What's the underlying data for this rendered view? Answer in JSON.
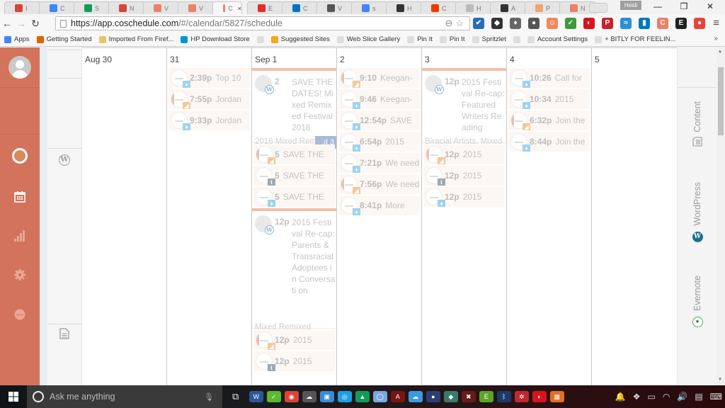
{
  "browser": {
    "tabs": [
      {
        "icon": "gmail-icon",
        "label": "I",
        "color": "#d44638"
      },
      {
        "icon": "google-calendar-icon",
        "label": "C",
        "color": "#4285f4"
      },
      {
        "icon": "google-drive-icon",
        "label": "S",
        "color": "#0f9d58"
      },
      {
        "icon": "gmail-icon",
        "label": "N",
        "color": "#d44638"
      },
      {
        "icon": "coschedule-icon",
        "label": "V",
        "color": "#e9826a"
      },
      {
        "icon": "coschedule-icon",
        "label": "V",
        "color": "#e9826a"
      },
      {
        "icon": "coschedule-icon",
        "label": "C",
        "color": "#e9826a",
        "active": true
      },
      {
        "icon": "youtube-icon",
        "label": "E",
        "color": "#e52d27"
      },
      {
        "icon": "outlook-icon",
        "label": "C",
        "color": "#0072c6"
      },
      {
        "icon": "site-icon",
        "label": "V",
        "color": "#555"
      },
      {
        "icon": "google-icon",
        "label": "s",
        "color": "#4285f4"
      },
      {
        "icon": "hootsuite-icon",
        "label": "H",
        "color": "#333"
      },
      {
        "icon": "office-icon",
        "label": "C",
        "color": "#eb3c00"
      },
      {
        "icon": "page-icon",
        "label": "H",
        "color": "#bbb"
      },
      {
        "icon": "g-icon",
        "label": "A",
        "color": "#333"
      },
      {
        "icon": "mailchimp-icon",
        "label": "P",
        "color": "#f0a56b"
      },
      {
        "icon": "coschedule-icon",
        "label": "N",
        "color": "#e9826a"
      }
    ],
    "tab_close": "×",
    "profile_name": "Heidi",
    "window_controls": {
      "minimize": "—",
      "restore": "❐",
      "close": "✕"
    },
    "url_host": "https://app.coschedule.com",
    "url_path": "/#/calendar/5827/schedule",
    "extensions": [
      {
        "name": "checklist-icon",
        "color": "#2a6db5",
        "glyph": "✔"
      },
      {
        "name": "hootsuite-icon",
        "color": "#333",
        "glyph": "◆"
      },
      {
        "name": "lamp-icon",
        "color": "#666",
        "glyph": "♦"
      },
      {
        "name": "evernote-icon",
        "color": "#555",
        "glyph": "●"
      },
      {
        "name": "mailchimp-icon",
        "color": "#f08a5d",
        "glyph": "☺"
      },
      {
        "name": "grammar-check-icon",
        "color": "#3d9a3d",
        "glyph": "✓"
      },
      {
        "name": "trend-micro-icon",
        "color": "#d9121e",
        "glyph": "◐"
      },
      {
        "name": "pinterest-icon",
        "color": "#cb2027",
        "glyph": "P"
      },
      {
        "name": "blue-wave-icon",
        "color": "#2b8fd6",
        "glyph": "≈"
      },
      {
        "name": "trello-icon",
        "color": "#0079bf",
        "glyph": "▮"
      },
      {
        "name": "coschedule-ext-icon",
        "color": "#e9826a",
        "glyph": "C"
      },
      {
        "name": "e-icon",
        "color": "#222",
        "glyph": "E"
      },
      {
        "name": "red-circle-icon",
        "color": "#e8443a",
        "glyph": "●"
      }
    ],
    "bookmarks": [
      {
        "icon": "apps-icon",
        "label": "Apps",
        "color": "#4285f4"
      },
      {
        "icon": "firefox-icon",
        "label": "Getting Started",
        "color": "#e66000"
      },
      {
        "icon": "folder-icon",
        "label": "Imported From Firef...",
        "color": "#e8c56a"
      },
      {
        "icon": "hp-icon",
        "label": "HP Download Store",
        "color": "#0096d6"
      },
      {
        "icon": "page-icon",
        "label": "",
        "color": "#ddd"
      },
      {
        "icon": "bing-icon",
        "label": "Suggested Sites",
        "color": "#f5a623"
      },
      {
        "icon": "page-icon",
        "label": "Web Slice Gallery",
        "color": "#ddd"
      },
      {
        "icon": "page-icon",
        "label": "Pin It",
        "color": "#ddd"
      },
      {
        "icon": "page-icon",
        "label": "Pin It",
        "color": "#ddd"
      },
      {
        "icon": "page-icon",
        "label": "Spritzlet",
        "color": "#ddd"
      },
      {
        "icon": "page-icon",
        "label": "",
        "color": "#ddd"
      },
      {
        "icon": "page-icon",
        "label": "Account Settings",
        "color": "#ddd"
      },
      {
        "icon": "page-icon",
        "label": "+ BITLY FOR FEELIN...",
        "color": "#ddd"
      }
    ],
    "bookmarks_more": "»"
  },
  "app": {
    "accent": "#d3735c",
    "nav": [
      "profile",
      "dashboard",
      "calendar",
      "analytics",
      "settings",
      "new"
    ],
    "days": [
      {
        "label": "Aug 30",
        "items": []
      },
      {
        "label": "31",
        "items": [
          {
            "time": "2:39p",
            "text": "Top 10",
            "network": "twitter"
          },
          {
            "time": "7:55p",
            "text": "Jordan",
            "network": "facebook",
            "photo": true
          },
          {
            "time": "9:33p",
            "text": "Jordan",
            "network": "twitter"
          }
        ]
      },
      {
        "label": "Sep 1",
        "blog1": {
          "count": "2",
          "title": "SAVE THE DATES! Mixed Remixed Festival 2016",
          "footer": "2016 Mixed Remixed",
          "stat": "3"
        },
        "items": [
          {
            "time": "5",
            "text": "SAVE THE",
            "network": "facebook",
            "photo": true
          },
          {
            "time": "5",
            "text": "SAVE THE",
            "network": "tumblr"
          },
          {
            "time": "5",
            "text": "SAVE THE",
            "network": "twitter"
          }
        ],
        "blog2": {
          "count": "12p",
          "title": "2015 Festival Re-cap: Parents & Transracial Adoptees in Conversati on",
          "footer": "Mixed Remixed"
        },
        "items2": [
          {
            "time": "12p",
            "text": "2015",
            "network": "facebook",
            "photo": true
          },
          {
            "time": "12p",
            "text": "2015",
            "network": "tumblr"
          }
        ]
      },
      {
        "label": "2",
        "items": [
          {
            "time": "9:10",
            "text": "Keegan-",
            "network": "facebook",
            "photo": true
          },
          {
            "time": "9:46",
            "text": "Keegan-",
            "network": "twitter"
          },
          {
            "time": "12:54p",
            "text": "SAVE",
            "network": "twitter"
          },
          {
            "time": "6:54p",
            "text": "2015",
            "network": "twitter"
          },
          {
            "time": "7:21p",
            "text": "We need",
            "network": "twitter"
          },
          {
            "time": "7:56p",
            "text": "We need",
            "network": "facebook",
            "photo": true
          },
          {
            "time": "8:41p",
            "text": "More",
            "network": "twitter"
          }
        ]
      },
      {
        "label": "3",
        "blog1": {
          "count": "12p",
          "title": "2015 Festival Re-cap: Featured Writers Reading",
          "footer": "Biracial Artists, Mixed"
        },
        "items": [
          {
            "time": "12p",
            "text": "2015",
            "network": "facebook",
            "photo": true
          },
          {
            "time": "12p",
            "text": "2015",
            "network": "tumblr"
          },
          {
            "time": "12p",
            "text": "2015",
            "network": "twitter"
          }
        ]
      },
      {
        "label": "4",
        "items": [
          {
            "time": "10:26",
            "text": "Call for",
            "network": "twitter"
          },
          {
            "time": "10:34",
            "text": "2015",
            "network": "twitter"
          },
          {
            "time": "6:32p",
            "text": "Join the",
            "network": "facebook",
            "photo": true
          },
          {
            "time": "8:44p",
            "text": "Join the",
            "network": "twitter"
          }
        ]
      },
      {
        "label": "5",
        "items": []
      }
    ],
    "right_tabs": [
      {
        "label": "Content",
        "icon": "content-icon"
      },
      {
        "label": "WordPress",
        "icon": "wordpress-icon"
      },
      {
        "label": "Evernote",
        "icon": "evernote-icon"
      }
    ]
  },
  "taskbar": {
    "search_placeholder": "Ask me anything",
    "apps": [
      {
        "name": "word-icon",
        "color": "#2b579a",
        "glyph": "W"
      },
      {
        "name": "green-check-icon",
        "color": "#5cb82e",
        "glyph": "✓"
      },
      {
        "name": "chrome-icon",
        "color": "#db4437",
        "glyph": "◉"
      },
      {
        "name": "onedrive-icon",
        "color": "#555",
        "glyph": "☁"
      },
      {
        "name": "app-icon",
        "color": "#3a8bd6",
        "glyph": "▣"
      },
      {
        "name": "app-icon",
        "color": "#1ba1e2",
        "glyph": "◎"
      },
      {
        "name": "google-drive-icon",
        "color": "#0f9d58",
        "glyph": "▲"
      },
      {
        "name": "app-icon",
        "color": "#7aa7e0",
        "glyph": "◯"
      },
      {
        "name": "acrobat-icon",
        "color": "#7a1414",
        "glyph": "A"
      },
      {
        "name": "icloud-icon",
        "color": "#3b9ae1",
        "glyph": "☁"
      },
      {
        "name": "app-icon",
        "color": "#2c3e75",
        "glyph": "●"
      },
      {
        "name": "app-icon",
        "color": "#3a7a6a",
        "glyph": "◆"
      },
      {
        "name": "network-error-icon",
        "color": "#6a1a1a",
        "glyph": "✖"
      },
      {
        "name": "evernote-icon",
        "color": "#5ba525",
        "glyph": "E"
      },
      {
        "name": "bluetooth-icon",
        "color": "#1a3a6a",
        "glyph": "ᛒ"
      },
      {
        "name": "app-icon",
        "color": "#c0282f",
        "glyph": "✲"
      },
      {
        "name": "trend-micro-icon",
        "color": "#d9121e",
        "glyph": "◐"
      },
      {
        "name": "app-icon",
        "color": "#e07020",
        "glyph": "▦"
      }
    ],
    "tray": [
      "notification-bell-icon",
      "dropbox-icon",
      "battery-icon",
      "wifi-icon",
      "volume-icon",
      "action-center-icon",
      "keyboard-icon"
    ]
  }
}
